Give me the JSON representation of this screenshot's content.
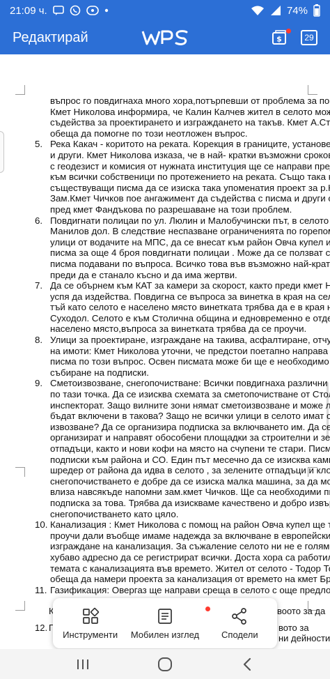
{
  "status_bar": {
    "time": "21:09 ч.",
    "battery": "74%"
  },
  "app_bar": {
    "title": "Редактирай",
    "logo": "WPS",
    "tab_count": "29"
  },
  "document": {
    "intro_lines": [
      "въпрос го повдигнаха много хора,потърпевши от проблема за пореден път.",
      "Кмет Николова информира, че Калин Калчев жител в селото може да",
      "съдейства за проектирането и изграждането на такъв. Кмет А.Стефанов",
      "обеща да помогне по този неотложен въпрос."
    ],
    "items": [
      {
        "number": "5.",
        "lines": [
          "Река Какач - коритото на реката. Корекция в границите, установен сервитут",
          "и други. Кмет Николова изказа, че в най- кратки възможни срокове заедно",
          "с геодезист и комисия от нужната институция ще се направи предписание",
          "към всички собственици по протежението на реката. Също така на база",
          "съществуващи писма да се изиска така упоменатия проект за р.Какач.",
          "Зам.Кмет Чичков пое ангажимент да  съдейства с писма и други способи",
          "пред кмет Фандъкова по разрешаване на този проблем."
        ]
      },
      {
        "number": "6.",
        "lines": [
          "Повдигнати полицаи по ул. Люлин и Малобучински път, в селото и м.",
          "Манилов дол. В следствие неспазване ограниченията по горепоменатите",
          "улици от водачите на МПС, да се внесат към район Овча купел и АПИ",
          "писма за още 4 броя повдигнати полицаи . Може да се ползват старите",
          "писма подавани по въпроса. Всичко това във възможно най-кратък срок",
          "преди да е станало късно и да има жертви."
        ]
      },
      {
        "number": "7.",
        "lines": [
          "Да се обърнем към КАТ за камери за скорост, както преди кмет Николова",
          "успя да издейства. Повдигна се въпроса за винетка в края на селото. Но",
          "тъй като селото е населено място винетката трябва да е в края на кв.",
          "Суходол. Селото е към Столична община и едновременно  е отделно",
          "населено място,въпроса за винетката трябва да се проучи."
        ]
      },
      {
        "number": "8.",
        "lines": [
          "Улици за проектиране, изграждане на такива, асфалтиране, отчуждаване",
          "на имоти: Кмет Николова уточни, че предстои поетапно направа на много",
          "писма по този въпрос. Освен писмата може би ще е необходимо и",
          "събиране на подписки."
        ]
      },
      {
        "number": "9.",
        "lines": [
          "Сметоизвозване, снегопочистване: Всички повдигнаха различни подтеми",
          "по тази точка. Да се изисква схемата за сметопочистване от Столичен",
          "инспекторат. Защо вилните зони нямат сметоизвозване и може ли да",
          "бъдат включени в такова? Защо не всички улици в селото имат смето",
          "извозване? Да се организира подписка за включването им. Да се",
          "организират и направят обособени площадки за строителни и зелени",
          "отпадъци, както и нови кофи на място на счупени те стари. Писма и",
          "подписки към района и СО. Един път месечно да се изисква камион-",
          "шредер от района да идва в селото , за зелените отпадъци и клоните. За",
          "снегопочистването е добре да се изиска малка машина, за да може да",
          "влиза навсякъде напомни зам.кмет Чичков. Ще са необходими писма и",
          "подписка за това. Трябва да изискваме качествено и добро извършване на",
          "снегопочистването като цяло."
        ]
      },
      {
        "number": "10.",
        "lines": [
          "Канализация : Кмет Николова с помощ на район Овча купел ще трябва да",
          "проучи дали въобще имаме надежда за включване в европейски проект за",
          "изграждане на канализация. За съжаление селото ни не е голямо и е",
          "хубаво адресно да се регистрират всички. Доста хора са работили по",
          "темата с канализацията във времето.  Жител от селото - Тодор Тодоров,",
          "обеща да намери проекта за канализация от времето на кмет Братоев."
        ]
      },
      {
        "number": "11.",
        "lines": [
          "Газификация: Овергаз ще направи среща в селото с още предложения."
        ]
      }
    ],
    "peek": {
      "line1_left": "К",
      "line1_right": "воото за да",
      "line2_num": "12.",
      "line2_left": "Г",
      "line2_right": "вото за",
      "line3_right": "ни дейности"
    }
  },
  "toolbar": {
    "tools_label": "Инструменти",
    "mobile_view_label": "Мобилен изглед",
    "share_label": "Сподели"
  },
  "colors": {
    "header": "#2c6fd6",
    "notification_dot": "#ff3b30"
  },
  "icons": [
    "message-icon",
    "viber-icon",
    "sim-icon",
    "more-icon",
    "wifi-icon",
    "signal-icon",
    "battery-icon",
    "document-badge-icon",
    "grid-tools-icon",
    "mobile-view-icon",
    "share-icon",
    "recent-apps-icon",
    "home-icon",
    "back-icon"
  ]
}
